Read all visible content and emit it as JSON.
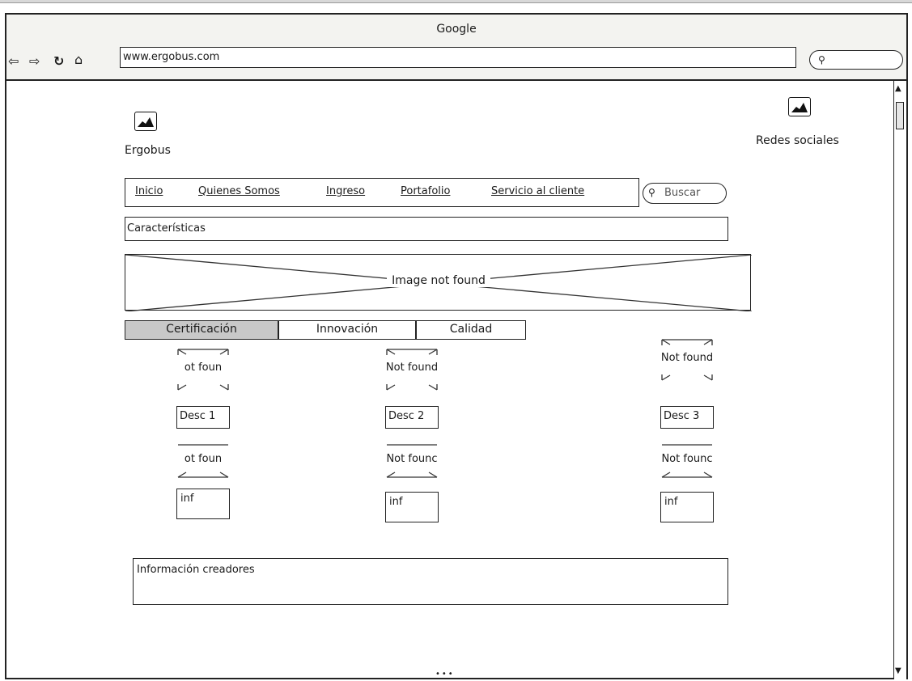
{
  "browser": {
    "window_title": "Google",
    "url": "www.ergobus.com",
    "nav_icons": [
      "back-arrow-icon",
      "forward-arrow-icon",
      "reload-icon",
      "home-icon"
    ]
  },
  "site": {
    "logo_label": "Ergobus",
    "social_label": "Redes sociales",
    "menu": [
      {
        "label": "Inicio"
      },
      {
        "label": "Quienes Somos"
      },
      {
        "label": "Ingreso"
      },
      {
        "label": "Portafolio"
      },
      {
        "label": "Servicio al cliente"
      }
    ],
    "search_placeholder": "Buscar",
    "features_label": "Características",
    "hero_label": "Image not found",
    "tabs": [
      {
        "label": "Certificación",
        "active": true
      },
      {
        "label": "Innovación",
        "active": false
      },
      {
        "label": "Calidad",
        "active": false
      }
    ],
    "columns": [
      {
        "image_label": "ot foun",
        "desc": "Desc 1",
        "image2_label": "ot foun",
        "info": "inf"
      },
      {
        "image_label": "Not found",
        "desc": "Desc 2",
        "image2_label": "Not founc",
        "info": "inf"
      },
      {
        "image_label": "Not found",
        "desc": "Desc 3",
        "image2_label": "Not founc",
        "info": "inf"
      }
    ],
    "creators_label": "Información creadores"
  }
}
